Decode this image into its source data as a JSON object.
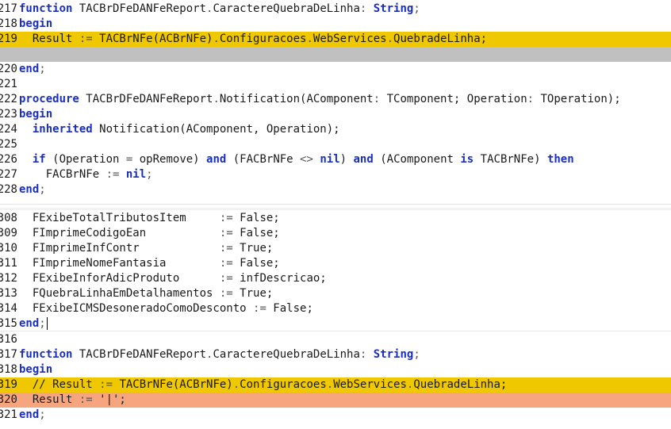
{
  "editor": {
    "pane1": {
      "lines": [
        {
          "num": "217",
          "tokens": [
            {
              "t": "function",
              "c": "kw"
            },
            {
              "t": " TACBrDFeDANFeReport"
            },
            {
              "t": ".",
              "c": "sym"
            },
            {
              "t": "CaractereQuebraDeLinha"
            },
            {
              "t": ":",
              "c": "sym"
            },
            {
              "t": " "
            },
            {
              "t": "String",
              "c": "kw"
            },
            {
              "t": ";",
              "c": "sym"
            }
          ]
        },
        {
          "num": "218",
          "tokens": [
            {
              "t": "begin",
              "c": "kw"
            }
          ]
        },
        {
          "num": "219",
          "hl": "yellow",
          "tokens": [
            {
              "t": "  Result "
            },
            {
              "t": ":=",
              "c": "sym"
            },
            {
              "t": " TACBrNFe(ACBrNFe)"
            },
            {
              "t": ".",
              "c": "sym"
            },
            {
              "t": "Configuracoes"
            },
            {
              "t": ".",
              "c": "sym"
            },
            {
              "t": "WebServices"
            },
            {
              "t": ".",
              "c": "sym"
            },
            {
              "t": "QuebradeLinha;"
            }
          ]
        },
        {
          "num": "",
          "hl": "gray",
          "tokens": []
        },
        {
          "num": "220",
          "tokens": [
            {
              "t": "end",
              "c": "kw"
            },
            {
              "t": ";",
              "c": "sym"
            }
          ]
        },
        {
          "num": "221",
          "tokens": []
        },
        {
          "num": "222",
          "tokens": [
            {
              "t": "procedure",
              "c": "kw"
            },
            {
              "t": " TACBrDFeDANFeReport"
            },
            {
              "t": ".",
              "c": "sym"
            },
            {
              "t": "Notification(AComponent"
            },
            {
              "t": ":",
              "c": "sym"
            },
            {
              "t": " TComponent; Operation"
            },
            {
              "t": ":",
              "c": "sym"
            },
            {
              "t": " TOperation);"
            }
          ]
        },
        {
          "num": "223",
          "tokens": [
            {
              "t": "begin",
              "c": "kw"
            }
          ]
        },
        {
          "num": "224",
          "tokens": [
            {
              "t": "  "
            },
            {
              "t": "inherited",
              "c": "kw"
            },
            {
              "t": " Notification(AComponent, Operation);"
            }
          ]
        },
        {
          "num": "225",
          "tokens": []
        },
        {
          "num": "226",
          "tokens": [
            {
              "t": "  "
            },
            {
              "t": "if",
              "c": "kw"
            },
            {
              "t": " (Operation "
            },
            {
              "t": "=",
              "c": "sym"
            },
            {
              "t": " opRemove) "
            },
            {
              "t": "and",
              "c": "kw"
            },
            {
              "t": " (FACBrNFe "
            },
            {
              "t": "<>",
              "c": "sym"
            },
            {
              "t": " "
            },
            {
              "t": "nil",
              "c": "kw"
            },
            {
              "t": ") "
            },
            {
              "t": "and",
              "c": "kw"
            },
            {
              "t": " (AComponent "
            },
            {
              "t": "is",
              "c": "kw"
            },
            {
              "t": " TACBrNFe) "
            },
            {
              "t": "then",
              "c": "kw"
            }
          ]
        },
        {
          "num": "227",
          "tokens": [
            {
              "t": "    FACBrNFe "
            },
            {
              "t": ":=",
              "c": "sym"
            },
            {
              "t": " "
            },
            {
              "t": "nil",
              "c": "kw"
            },
            {
              "t": ";",
              "c": "sym"
            }
          ]
        },
        {
          "num": "228",
          "tokens": [
            {
              "t": "end",
              "c": "kw"
            },
            {
              "t": ";",
              "c": "sym"
            }
          ]
        }
      ]
    },
    "pane2": {
      "lines": [
        {
          "num": "308",
          "tokens": [
            {
              "t": "  FExibeTotalTributosItem     "
            },
            {
              "t": ":=",
              "c": "sym"
            },
            {
              "t": " False;"
            }
          ]
        },
        {
          "num": "309",
          "tokens": [
            {
              "t": "  FImprimeCodigoEan           "
            },
            {
              "t": ":=",
              "c": "sym"
            },
            {
              "t": " False;"
            }
          ]
        },
        {
          "num": "310",
          "tokens": [
            {
              "t": "  FImprimeInfContr            "
            },
            {
              "t": ":=",
              "c": "sym"
            },
            {
              "t": " True;"
            }
          ]
        },
        {
          "num": "311",
          "tokens": [
            {
              "t": "  FImprimeNomeFantasia        "
            },
            {
              "t": ":=",
              "c": "sym"
            },
            {
              "t": " False;"
            }
          ]
        },
        {
          "num": "312",
          "tokens": [
            {
              "t": "  FExibeInforAdicProduto      "
            },
            {
              "t": ":=",
              "c": "sym"
            },
            {
              "t": " infDescricao;"
            }
          ]
        },
        {
          "num": "313",
          "tokens": [
            {
              "t": "  FQuebraLinhaEmDetalhamentos "
            },
            {
              "t": ":=",
              "c": "sym"
            },
            {
              "t": " True;"
            }
          ]
        },
        {
          "num": "314",
          "tokens": [
            {
              "t": "  FExibeICMSDesoneradoComoDesconto "
            },
            {
              "t": ":=",
              "c": "sym"
            },
            {
              "t": " False;"
            }
          ]
        },
        {
          "num": "315",
          "caret": true,
          "tokens": [
            {
              "t": "end",
              "c": "kw"
            },
            {
              "t": ";",
              "c": "sym"
            }
          ]
        }
      ]
    },
    "pane3": {
      "lines": [
        {
          "num": "316",
          "tokens": []
        },
        {
          "num": "317",
          "tokens": [
            {
              "t": "function",
              "c": "kw"
            },
            {
              "t": " TACBrDFeDANFeReport"
            },
            {
              "t": ".",
              "c": "sym"
            },
            {
              "t": "CaractereQuebraDeLinha"
            },
            {
              "t": ":",
              "c": "sym"
            },
            {
              "t": " "
            },
            {
              "t": "String",
              "c": "kw"
            },
            {
              "t": ";",
              "c": "sym"
            }
          ]
        },
        {
          "num": "318",
          "tokens": [
            {
              "t": "begin",
              "c": "kw"
            }
          ]
        },
        {
          "num": "319",
          "hl": "yellow",
          "tokens": [
            {
              "t": "  // Result "
            },
            {
              "t": ":=",
              "c": "sym"
            },
            {
              "t": " TACBrNFe(ACBrNFe)"
            },
            {
              "t": ".",
              "c": "sym"
            },
            {
              "t": "Configuracoes"
            },
            {
              "t": ".",
              "c": "sym"
            },
            {
              "t": "WebServices"
            },
            {
              "t": ".",
              "c": "sym"
            },
            {
              "t": "QuebradeLinha;"
            }
          ]
        },
        {
          "num": "320",
          "hl": "salmon",
          "tokens": [
            {
              "t": "  Result "
            },
            {
              "t": ":=",
              "c": "sym"
            },
            {
              "t": " '|';"
            }
          ]
        },
        {
          "num": "321",
          "tokens": [
            {
              "t": "end",
              "c": "kw"
            },
            {
              "t": ";",
              "c": "sym"
            }
          ]
        }
      ]
    }
  },
  "colors": {
    "keyword": "#1a2fbf",
    "highlight_yellow": "#f0c800",
    "highlight_salmon": "#f6a57f",
    "highlight_gray": "#c0c0c0"
  }
}
